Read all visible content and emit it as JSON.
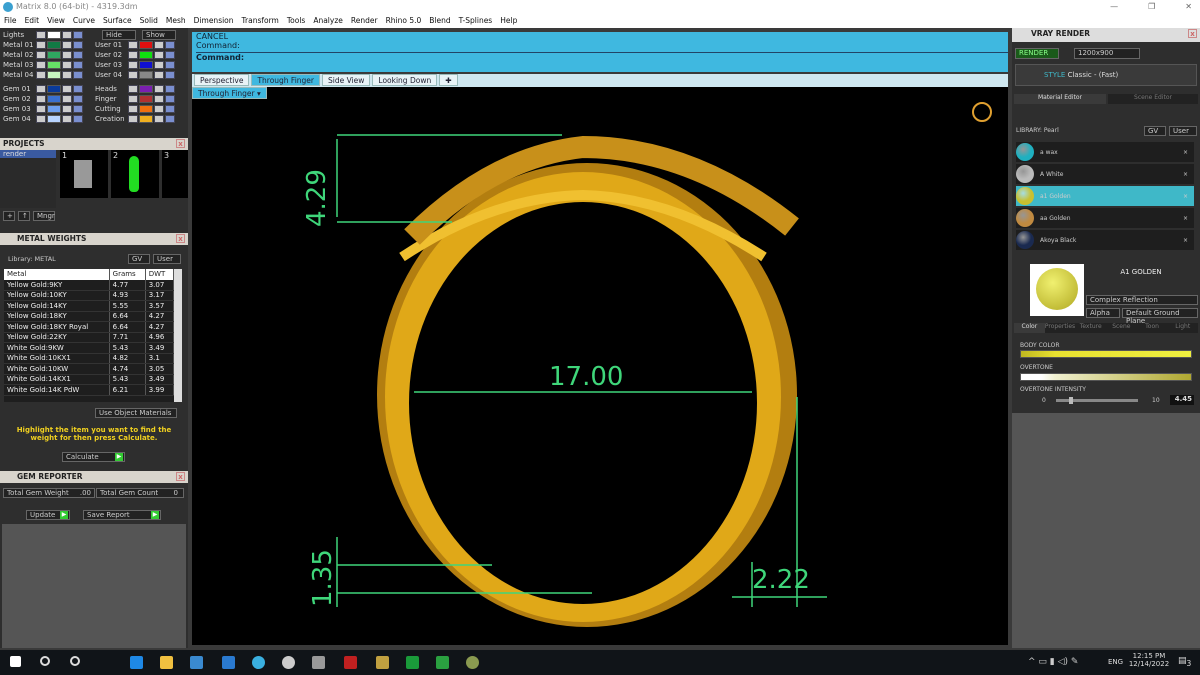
{
  "window": {
    "title": "Matrix 8.0 (64-bit) - 4319.3dm",
    "controls": [
      "—",
      "❐",
      "✕"
    ]
  },
  "menu": [
    "File",
    "Edit",
    "View",
    "Curve",
    "Surface",
    "Solid",
    "Mesh",
    "Dimension",
    "Transform",
    "Tools",
    "Analyze",
    "Render",
    "Rhino 5.0",
    "Blend",
    "T-Splines",
    "Help"
  ],
  "layers": {
    "lights": "Lights",
    "hide": "Hide",
    "show": "Show",
    "left": [
      {
        "name": "Metal 01",
        "color": "#117a44"
      },
      {
        "name": "Metal 02",
        "color": "#2fa860"
      },
      {
        "name": "Metal 03",
        "color": "#66e066"
      },
      {
        "name": "Metal 04",
        "color": "#c8f5c0"
      },
      {
        "name": "Gem 01",
        "color": "#0a3a9a"
      },
      {
        "name": "Gem 02",
        "color": "#3a70d0"
      },
      {
        "name": "Gem 03",
        "color": "#6fa0f0"
      },
      {
        "name": "Gem 04",
        "color": "#b8d4ff"
      }
    ],
    "right": [
      {
        "name": "User 01",
        "color": "#e01010"
      },
      {
        "name": "User 02",
        "color": "#10e010"
      },
      {
        "name": "User 03",
        "color": "#1010d0"
      },
      {
        "name": "User 04",
        "color": "#888888"
      },
      {
        "name": "Heads",
        "color": "#7a1fb0"
      },
      {
        "name": "Finger",
        "color": "#b03030"
      },
      {
        "name": "Cutting",
        "color": "#f07010"
      },
      {
        "name": "Creation",
        "color": "#f0b020"
      }
    ]
  },
  "projects": {
    "title": "PROJECTS",
    "items": [
      "render"
    ],
    "thumbs": [
      "1",
      "2",
      "3"
    ],
    "mngr": "Mngr"
  },
  "metal_weights": {
    "title": "METAL WEIGHTS",
    "library": "Library: METAL",
    "gv": "GV",
    "user": "User",
    "columns": [
      "Metal",
      "Grams",
      "DWT"
    ],
    "rows": [
      [
        "Yellow Gold:9KY",
        "4.77",
        "3.07"
      ],
      [
        "Yellow Gold:10KY",
        "4.93",
        "3.17"
      ],
      [
        "Yellow Gold:14KY",
        "5.55",
        "3.57"
      ],
      [
        "Yellow Gold:18KY",
        "6.64",
        "4.27"
      ],
      [
        "Yellow Gold:18KY Royal",
        "6.64",
        "4.27"
      ],
      [
        "Yellow Gold:22KY",
        "7.71",
        "4.96"
      ],
      [
        "White Gold:9KW",
        "5.43",
        "3.49"
      ],
      [
        "White Gold:10KX1",
        "4.82",
        "3.1"
      ],
      [
        "White Gold:10KW",
        "4.74",
        "3.05"
      ],
      [
        "White Gold:14KX1",
        "5.43",
        "3.49"
      ],
      [
        "White Gold:14K PdW",
        "6.21",
        "3.99"
      ]
    ],
    "use_object": "Use Object Materials",
    "hint": "Highlight the item you want to find the weight for then press Calculate.",
    "calculate": "Calculate"
  },
  "gem_reporter": {
    "title": "GEM REPORTER",
    "weight_label": "Total Gem Weight",
    "weight": ".00",
    "count_label": "Total Gem Count",
    "count": "0",
    "update": "Update",
    "save": "Save Report"
  },
  "command": {
    "line1": "CANCEL",
    "line2": "Command:",
    "prompt": "Command:"
  },
  "view_tabs": [
    "Perspective",
    "Through Finger",
    "Side View",
    "Looking Down",
    "✚"
  ],
  "active_tab": "Through Finger",
  "viewport_label": "Through Finger",
  "dimensions": {
    "top": "4.29",
    "width": "17.00",
    "bottom": "1.35",
    "band": "2.22"
  },
  "dim_color": "#3fd67a",
  "ring_color": "#e0a818",
  "vray": {
    "title": "VRAY RENDER",
    "render": "RENDER",
    "resolution": "1200x900",
    "style_label": "STYLE",
    "style": "Classic - (Fast)",
    "tabs": [
      "Material Editor",
      "Scene Editor"
    ],
    "library": "LIBRARY: Pearl",
    "gv": "GV",
    "user": "User",
    "materials": [
      {
        "name": "a wax",
        "color": "#1fb0c0"
      },
      {
        "name": "A White",
        "color": "#bbbbbb"
      },
      {
        "name": "a1 Golden",
        "color": "#c8c030",
        "selected": true
      },
      {
        "name": "aa Golden",
        "color": "#c08a40"
      },
      {
        "name": "Akoya Black",
        "color": "#1a2a50"
      }
    ],
    "selected_name": "A1 GOLDEN",
    "reflection": "Complex Reflection",
    "alpha": "Alpha",
    "ground": "Default Ground Plane",
    "subtabs": [
      "Color",
      "Properties",
      "Texture",
      "Scene",
      "Toon",
      "Light"
    ],
    "body_color": "BODY COLOR",
    "overtone": "OVERTONE",
    "overtone_intensity": "OVERTONE INTENSITY",
    "min": "0",
    "max": "10",
    "intensity": "4.45",
    "intensity_fraction": 0.445
  },
  "taskbar": {
    "lang": "ENG",
    "time": "12:15 PM",
    "date": "12/14/2022",
    "notifications": "3"
  }
}
